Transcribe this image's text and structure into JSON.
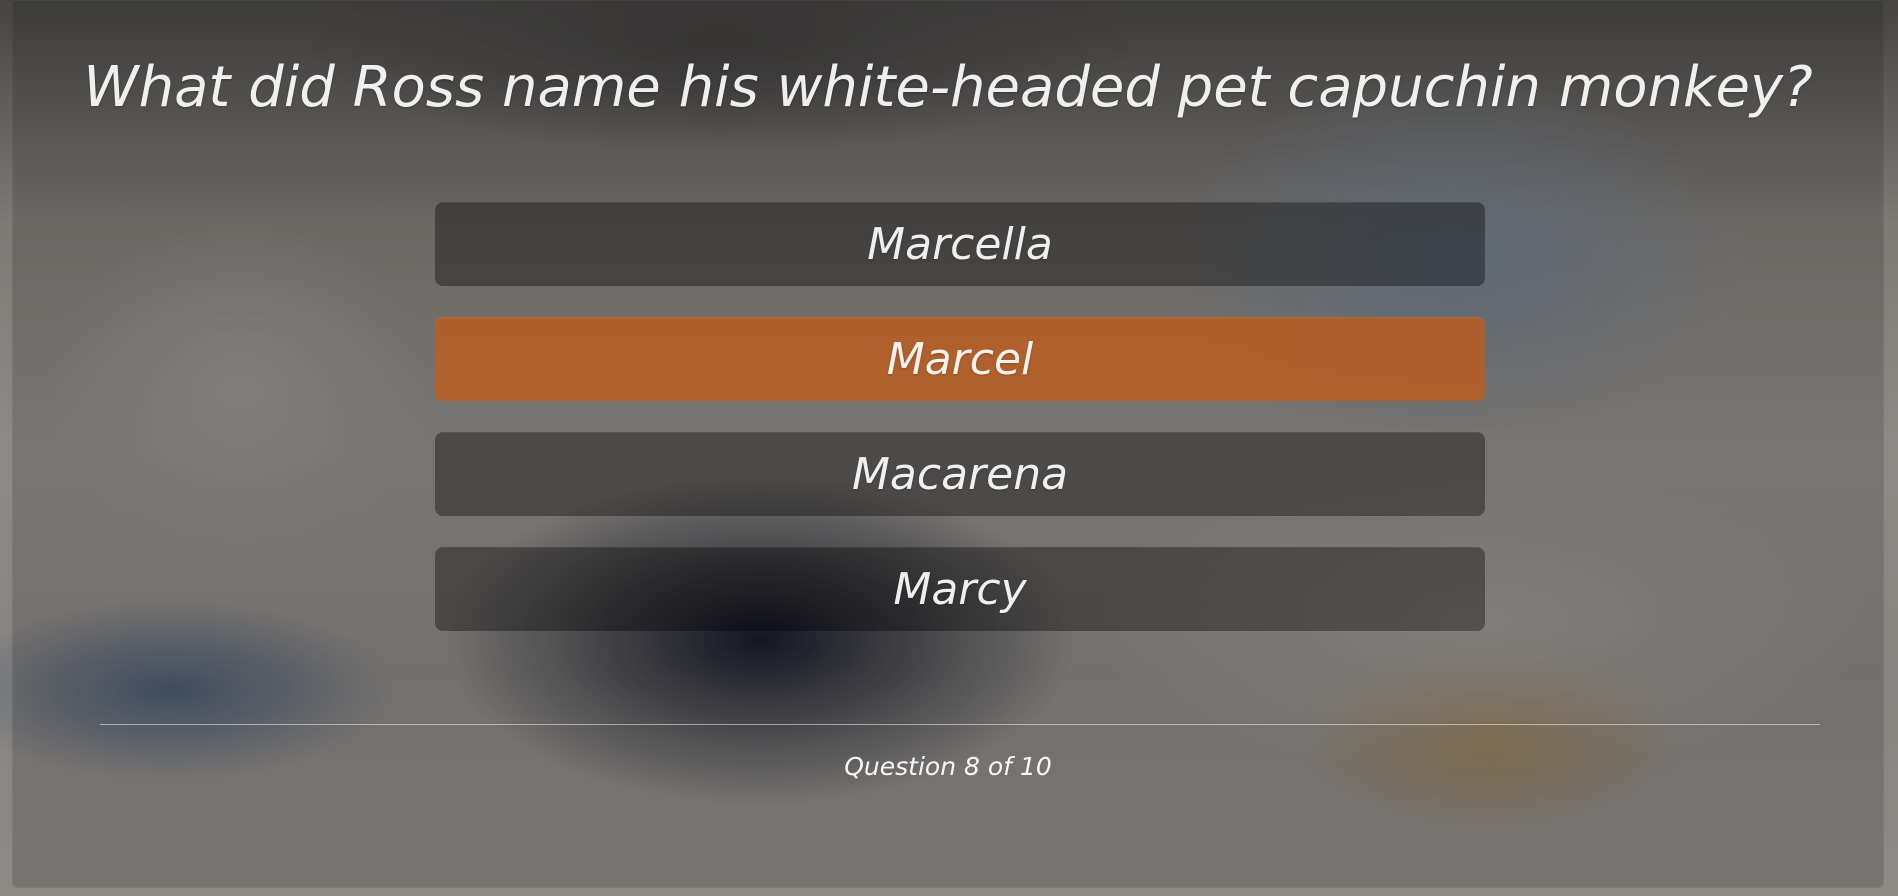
{
  "quiz": {
    "question": "What did Ross name his white-headed pet capuchin monkey?",
    "answers": [
      {
        "label": "Marcella"
      },
      {
        "label": "Marcel"
      },
      {
        "label": "Macarena"
      },
      {
        "label": "Marcy"
      }
    ],
    "progress_text": "Question 8 of 10"
  },
  "colors": {
    "selected_answer": "#C85A14",
    "answer_background": "#2B2B2B"
  }
}
